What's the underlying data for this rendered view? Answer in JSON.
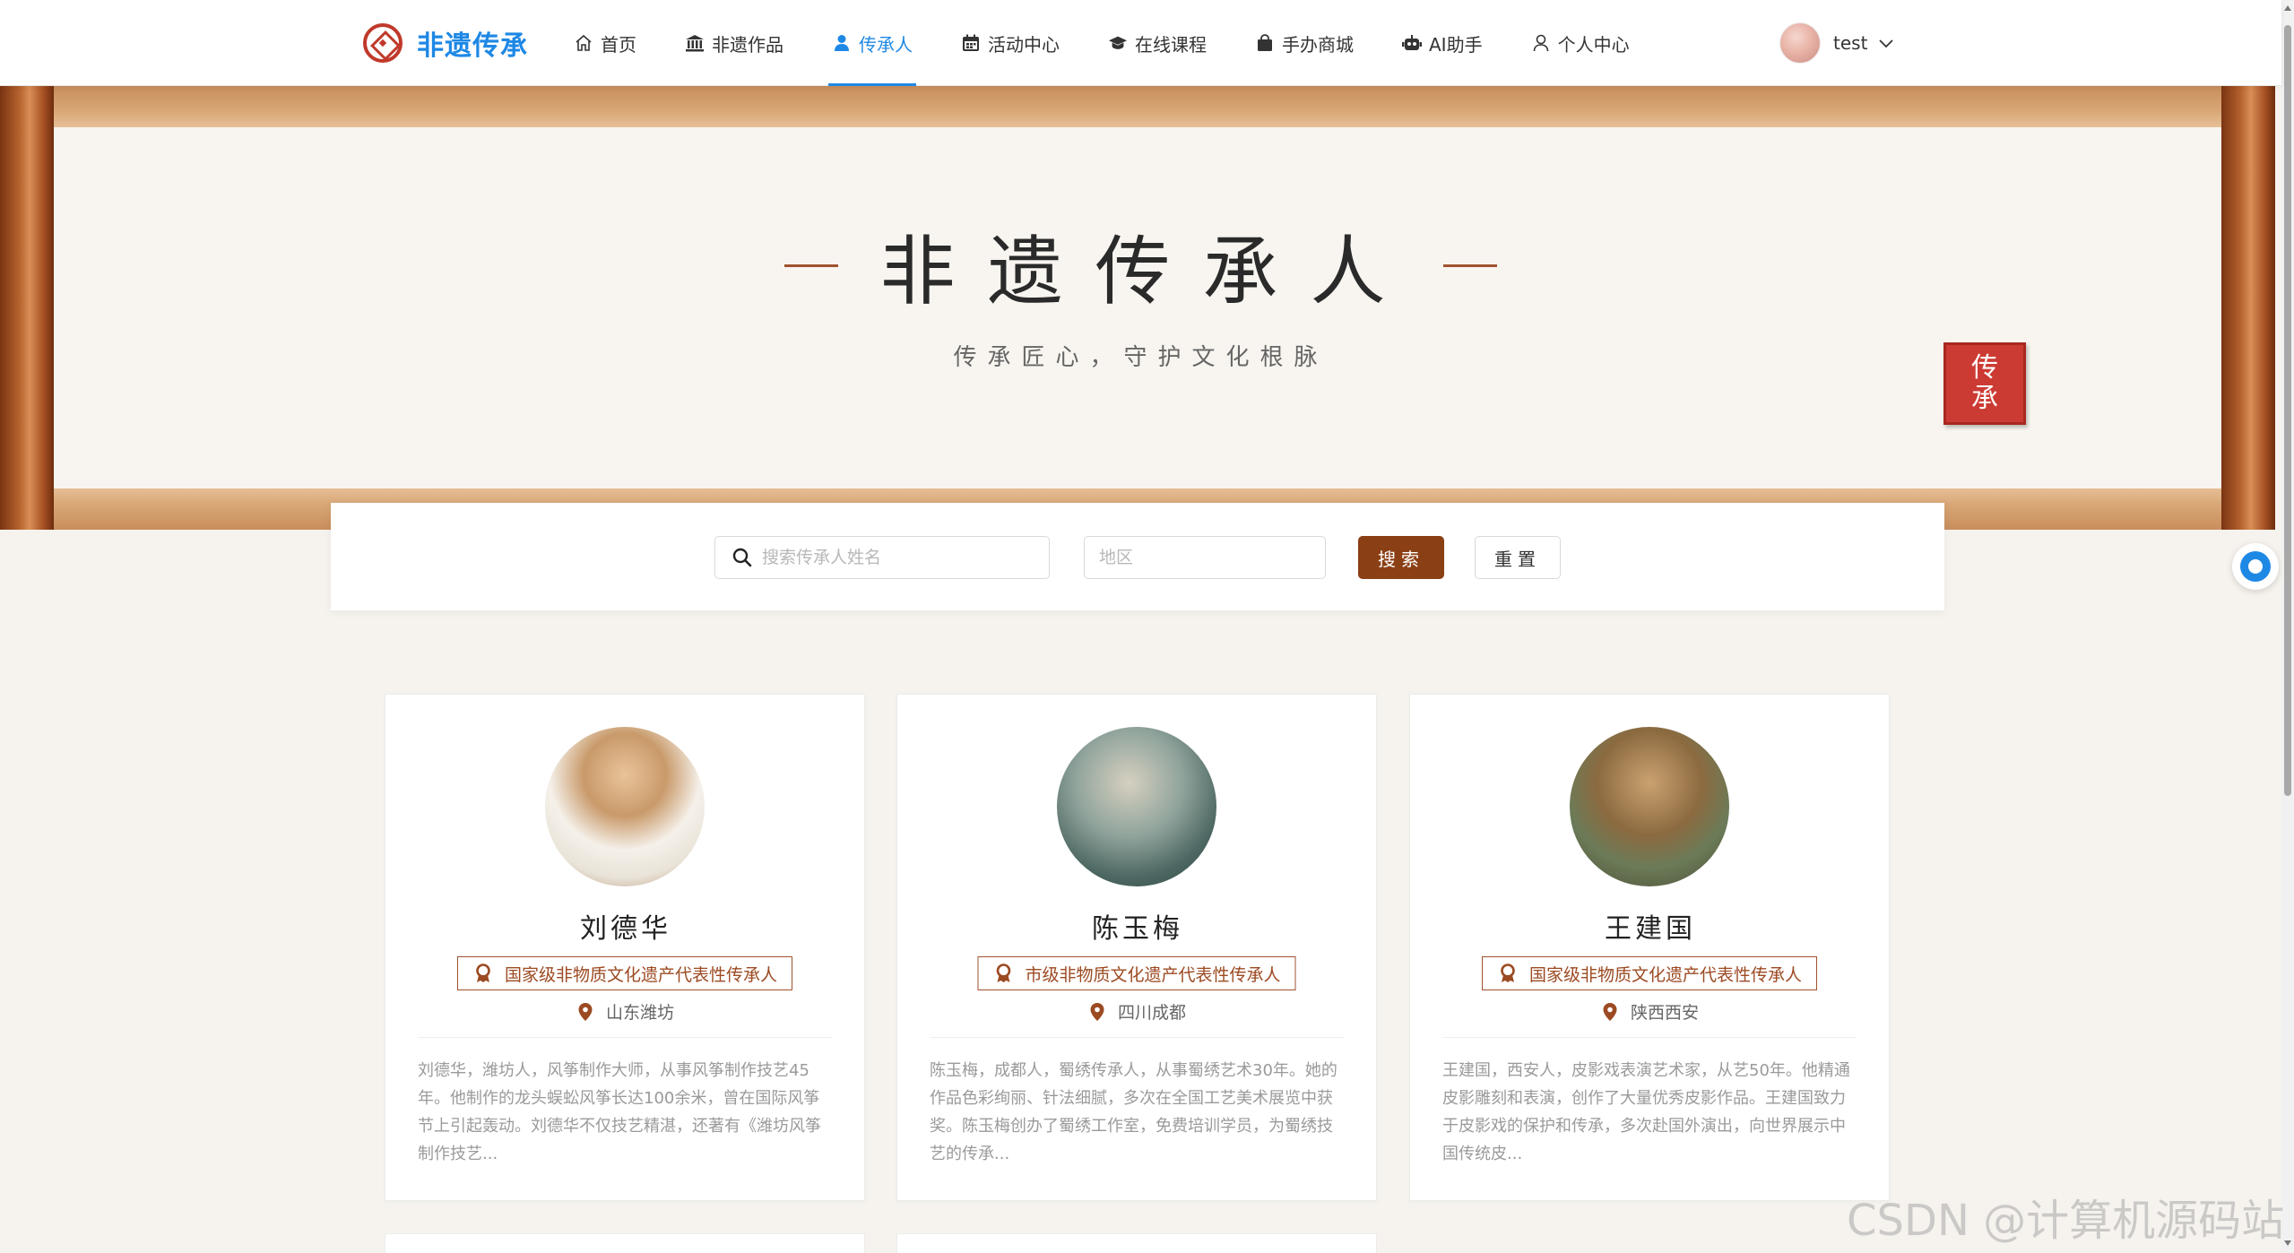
{
  "brand": {
    "name": "非遗传承"
  },
  "nav": {
    "items": [
      {
        "label": "首页",
        "icon": "home-icon",
        "active": false
      },
      {
        "label": "非遗作品",
        "icon": "museum-icon",
        "active": false
      },
      {
        "label": "传承人",
        "icon": "user-icon",
        "active": true
      },
      {
        "label": "活动中心",
        "icon": "calendar-icon",
        "active": false
      },
      {
        "label": "在线课程",
        "icon": "graduation-cap-icon",
        "active": false
      },
      {
        "label": "手办商城",
        "icon": "shopping-bag-icon",
        "active": false
      },
      {
        "label": "AI助手",
        "icon": "robot-icon",
        "active": false
      },
      {
        "label": "个人中心",
        "icon": "person-icon",
        "active": false
      }
    ],
    "active_color": "#1e88e5"
  },
  "user": {
    "name": "test"
  },
  "banner": {
    "title": "非遗传承人",
    "subtitle": "传承匠心，守护文化根脉",
    "seal_top": "传",
    "seal_bottom": "承"
  },
  "search": {
    "name_placeholder": "搜索传承人姓名",
    "name_value": "",
    "region_placeholder": "地区",
    "region_value": "",
    "search_label": "搜索",
    "reset_label": "重置"
  },
  "inheritors": [
    {
      "name": "刘德华",
      "level": "国家级非物质文化遗产代表性传承人",
      "location": "山东潍坊",
      "description": "刘德华，潍坊人，风筝制作大师，从事风筝制作技艺45年。他制作的龙头蜈蚣风筝长达100余米，曾在国际风筝节上引起轰动。刘德华不仅技艺精湛，还著有《潍坊风筝制作技艺..."
    },
    {
      "name": "陈玉梅",
      "level": "市级非物质文化遗产代表性传承人",
      "location": "四川成都",
      "description": "陈玉梅，成都人，蜀绣传承人，从事蜀绣艺术30年。她的作品色彩绚丽、针法细腻，多次在全国工艺美术展览中获奖。陈玉梅创办了蜀绣工作室，免费培训学员，为蜀绣技艺的传承..."
    },
    {
      "name": "王建国",
      "level": "国家级非物质文化遗产代表性传承人",
      "location": "陕西西安",
      "description": "王建国，西安人，皮影戏表演艺术家，从艺50年。他精通皮影雕刻和表演，创作了大量优秀皮影作品。王建国致力于皮影戏的保护和传承，多次赴国外演出，向世界展示中国传统皮..."
    }
  ],
  "colors": {
    "accent_brown": "#8b3f14",
    "tag_border": "#a0522d",
    "seal_red": "#cc3b33",
    "background": "#f6f3ee"
  },
  "watermark": "CSDN @计算机源码站"
}
